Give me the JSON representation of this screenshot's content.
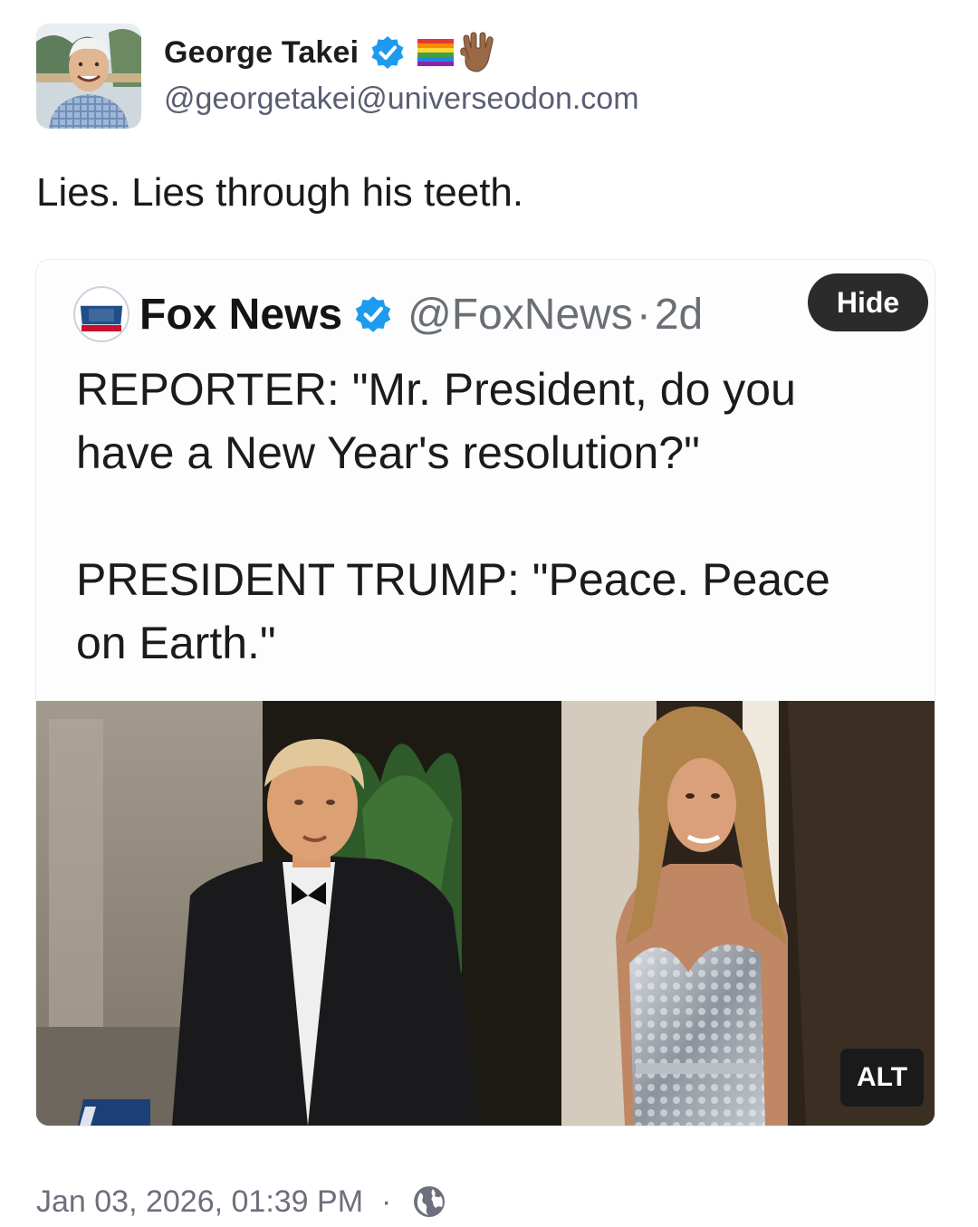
{
  "author": {
    "display_name": "George Takei",
    "handle": "@georgetakei@universeodon.com",
    "verified": true,
    "name_emojis": [
      "rainbow-flag-icon",
      "vulcan-salute-icon"
    ]
  },
  "post": {
    "text": "Lies. Lies through his teeth."
  },
  "media": {
    "hide_label": "Hide",
    "alt_label": "ALT",
    "embedded_tweet": {
      "name": "Fox News",
      "handle": "@FoxNews",
      "separator": "·",
      "age": "2d",
      "lines": [
        "REPORTER: \"Mr. President, do you have a New Year's resolution?\"",
        "PRESIDENT TRUMP: \"Peace. Peace on Earth.\""
      ]
    }
  },
  "footer": {
    "timestamp": "Jan 03, 2026, 01:39 PM",
    "separator": "·",
    "visibility_icon": "globe-icon"
  },
  "colors": {
    "verified_blue": "#1d9bf0",
    "muted_text": "#5b5e72",
    "hide_button_bg": "#2b2b2b"
  }
}
